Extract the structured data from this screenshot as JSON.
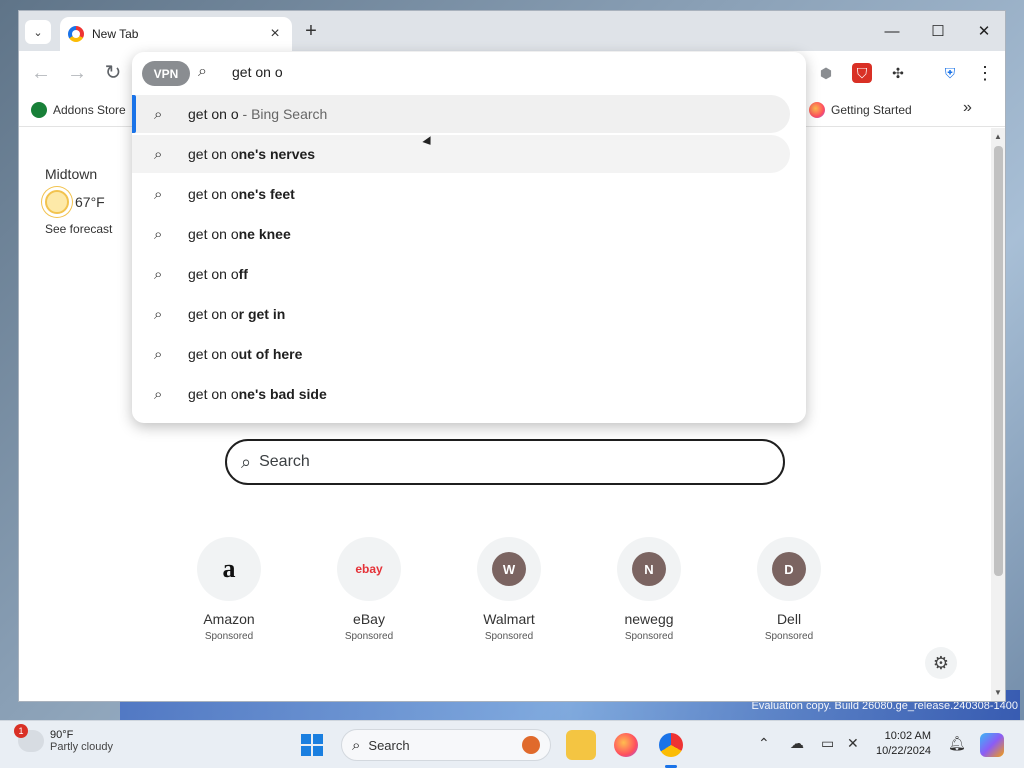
{
  "desktop": {
    "eval_text": "Evaluation copy. Build 26080.ge_release.240308-1400"
  },
  "browser": {
    "tab": {
      "title": "New Tab",
      "close_icon": "×"
    },
    "new_tab_icon": "+",
    "window_controls": {
      "minimize": "—",
      "maximize": "☐",
      "close": "✕"
    },
    "nav": {
      "back": "←",
      "forward": "→",
      "reload": "↻"
    },
    "menu_icon": "⋮"
  },
  "bookmarks": {
    "left": "Addons Store",
    "right": "Getting Started",
    "overflow": "»"
  },
  "omnibox": {
    "vpn_label": "VPN",
    "search_icon": "⌕",
    "value": "get on o",
    "suggestions": [
      {
        "typed": "get on o",
        "bold": "",
        "source_sep": " - ",
        "source": "Bing Search"
      },
      {
        "typed": "get on o",
        "bold": "ne's nerves"
      },
      {
        "typed": "get on o",
        "bold": "ne's feet"
      },
      {
        "typed": "get on o",
        "bold": "ne knee"
      },
      {
        "typed": "get on o",
        "bold": "ff"
      },
      {
        "typed": "get on o",
        "bold": "r get in"
      },
      {
        "typed": "get on o",
        "bold": "ut of here"
      },
      {
        "typed": "get on o",
        "bold": "ne's bad side"
      }
    ]
  },
  "newtab": {
    "weather": {
      "location": "Midtown",
      "temp": "67°F",
      "link": "See forecast"
    },
    "search_placeholder": "Search",
    "tiles": [
      {
        "name": "Amazon",
        "sponsored": "Sponsored",
        "initial": "a",
        "color": "#ffffff"
      },
      {
        "name": "eBay",
        "sponsored": "Sponsored",
        "initial": "ebay",
        "color": "#ffffff"
      },
      {
        "name": "Walmart",
        "sponsored": "Sponsored",
        "initial": "W",
        "color": "#7b6461"
      },
      {
        "name": "newegg",
        "sponsored": "Sponsored",
        "initial": "N",
        "color": "#7b6461"
      },
      {
        "name": "Dell",
        "sponsored": "Sponsored",
        "initial": "D",
        "color": "#7b6461"
      }
    ]
  },
  "taskbar": {
    "weather": {
      "temp": "90°F",
      "desc": "Partly cloudy",
      "badge": "1"
    },
    "search_label": "Search",
    "time": "10:02 AM",
    "date": "10/22/2024"
  },
  "colors": {
    "accent": "#1a73e8",
    "selection_bar": "#1a73e8"
  }
}
